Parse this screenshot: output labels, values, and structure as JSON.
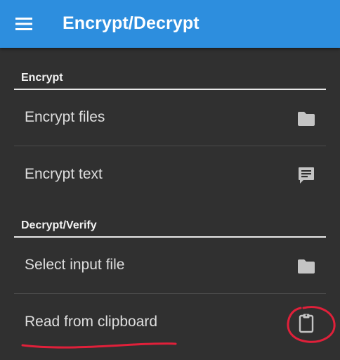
{
  "appbar": {
    "title": "Encrypt/Decrypt",
    "menu_icon": "hamburger-menu-icon",
    "color": "#2d8ede"
  },
  "sections": {
    "encrypt": {
      "title": "Encrypt",
      "items": [
        {
          "label": "Encrypt files",
          "icon": "folder-icon"
        },
        {
          "label": "Encrypt text",
          "icon": "message-icon"
        }
      ]
    },
    "decrypt": {
      "title": "Decrypt/Verify",
      "items": [
        {
          "label": "Select input file",
          "icon": "folder-icon"
        },
        {
          "label": "Read from clipboard",
          "icon": "clipboard-icon"
        }
      ]
    }
  },
  "annotation": {
    "color": "#e0203a"
  }
}
